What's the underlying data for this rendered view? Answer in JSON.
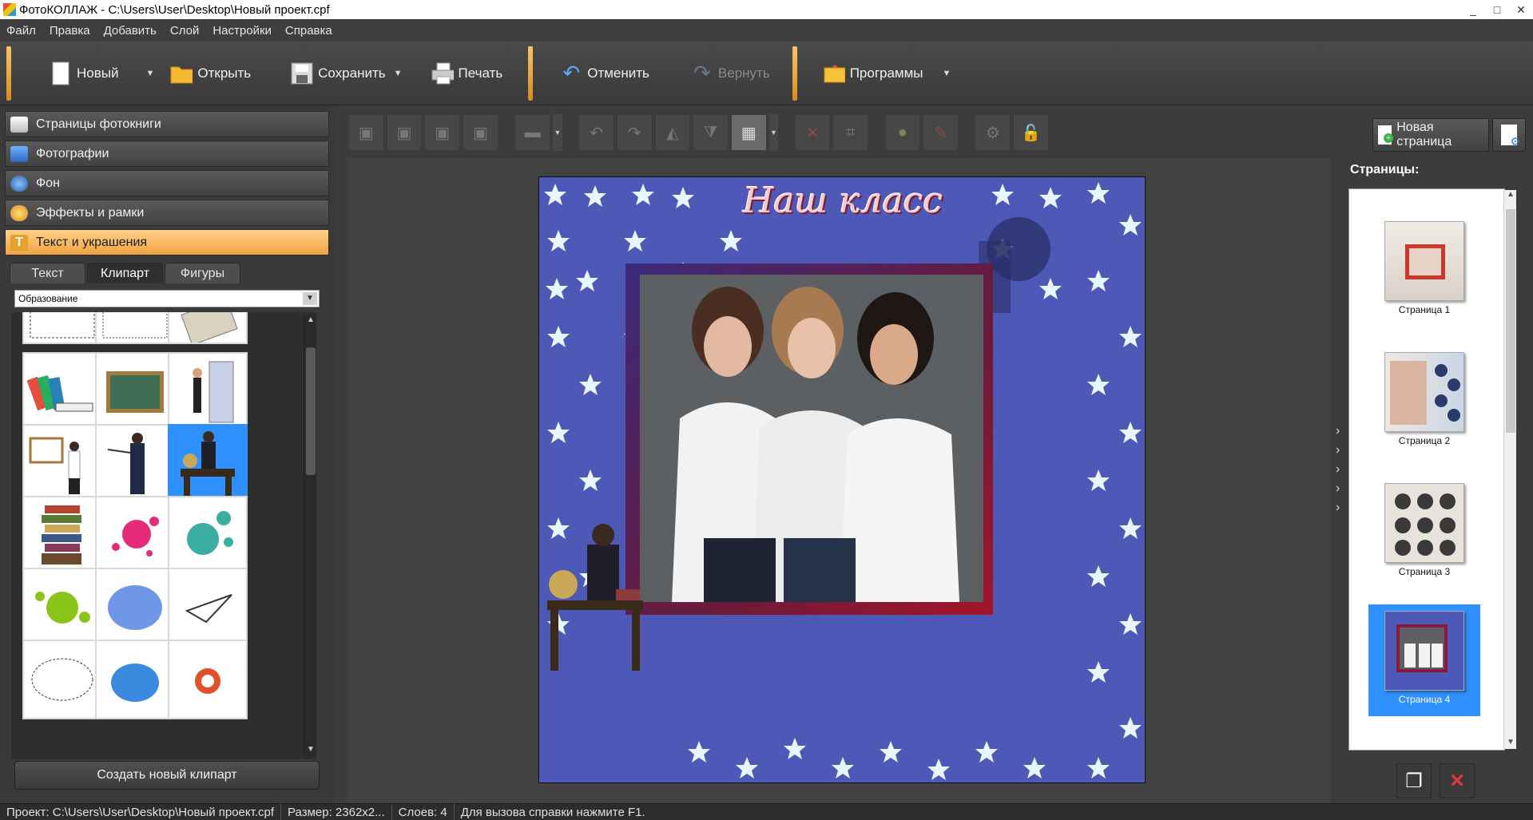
{
  "window": {
    "title": "ФотоКОЛЛАЖ - C:\\Users\\User\\Desktop\\Новый проект.cpf",
    "minimize": "_",
    "maximize": "□",
    "close": "✕"
  },
  "menu": [
    "Файл",
    "Правка",
    "Добавить",
    "Слой",
    "Настройки",
    "Справка"
  ],
  "toolbar": {
    "new_label": "Новый",
    "open_label": "Открыть",
    "save_label": "Сохранить",
    "print_label": "Печать",
    "undo_label": "Отменить",
    "redo_label": "Вернуть",
    "programs_label": "Программы",
    "dropdown_glyph": "▼"
  },
  "left_panel": {
    "sections": [
      {
        "label": "Страницы фотокниги",
        "icon": "book-icon"
      },
      {
        "label": "Фотографии",
        "icon": "photo-icon"
      },
      {
        "label": "Фон",
        "icon": "palette-icon"
      },
      {
        "label": "Эффекты и рамки",
        "icon": "effects-icon"
      },
      {
        "label": "Текст и украшения",
        "icon": "text-icon",
        "active": true
      }
    ],
    "tabs": [
      "Текст",
      "Клипарт",
      "Фигуры"
    ],
    "active_tab": "Клипарт",
    "category": "Образование",
    "create_clipart_label": "Создать новый клипарт"
  },
  "edit_toolbar": {
    "groups": [
      [
        "bring-front-icon",
        "bring-forward-icon",
        "send-backward-icon",
        "send-back-icon"
      ],
      [
        "align-icon"
      ],
      [
        "rotate-left-icon",
        "rotate-right-icon",
        "flip-horizontal-icon",
        "flip-vertical-icon",
        "fit-icon"
      ],
      [
        "delete-icon",
        "crop-icon"
      ],
      [
        "effects-icon",
        "eyedropper-icon"
      ],
      [
        "settings-icon",
        "lock-icon"
      ]
    ],
    "glyphs": {
      "bring-front-icon": "▣",
      "bring-forward-icon": "▣",
      "send-backward-icon": "▣",
      "send-back-icon": "▣",
      "align-icon": "▬",
      "rotate-left-icon": "↶",
      "rotate-right-icon": "↷",
      "flip-horizontal-icon": "◭",
      "flip-vertical-icon": "⧩",
      "fit-icon": "▦",
      "delete-icon": "✕",
      "crop-icon": "⌗",
      "effects-icon": "●",
      "eyedropper-icon": "✎",
      "settings-icon": "⚙",
      "lock-icon": "🔓"
    }
  },
  "canvas": {
    "heading": "Наш класс"
  },
  "right_panel": {
    "new_page_label": "Новая страница",
    "pages_title": "Страницы:",
    "pages": [
      {
        "label": "Страница 1",
        "selected": false
      },
      {
        "label": "Страница 2",
        "selected": false
      },
      {
        "label": "Страница 3",
        "selected": false
      },
      {
        "label": "Страница 4",
        "selected": true
      }
    ],
    "collapse_glyph": "›"
  },
  "status": {
    "project": "Проект:  C:\\Users\\User\\Desktop\\Новый проект.cpf",
    "size": "Размер:  2362x2...",
    "layers": "Слоев:  4",
    "hint": "Для вызова справки нажмите F1."
  },
  "colors": {
    "accent_orange": "#f0a340",
    "selection_blue": "#2f90ff",
    "delete_red": "#e53935"
  }
}
